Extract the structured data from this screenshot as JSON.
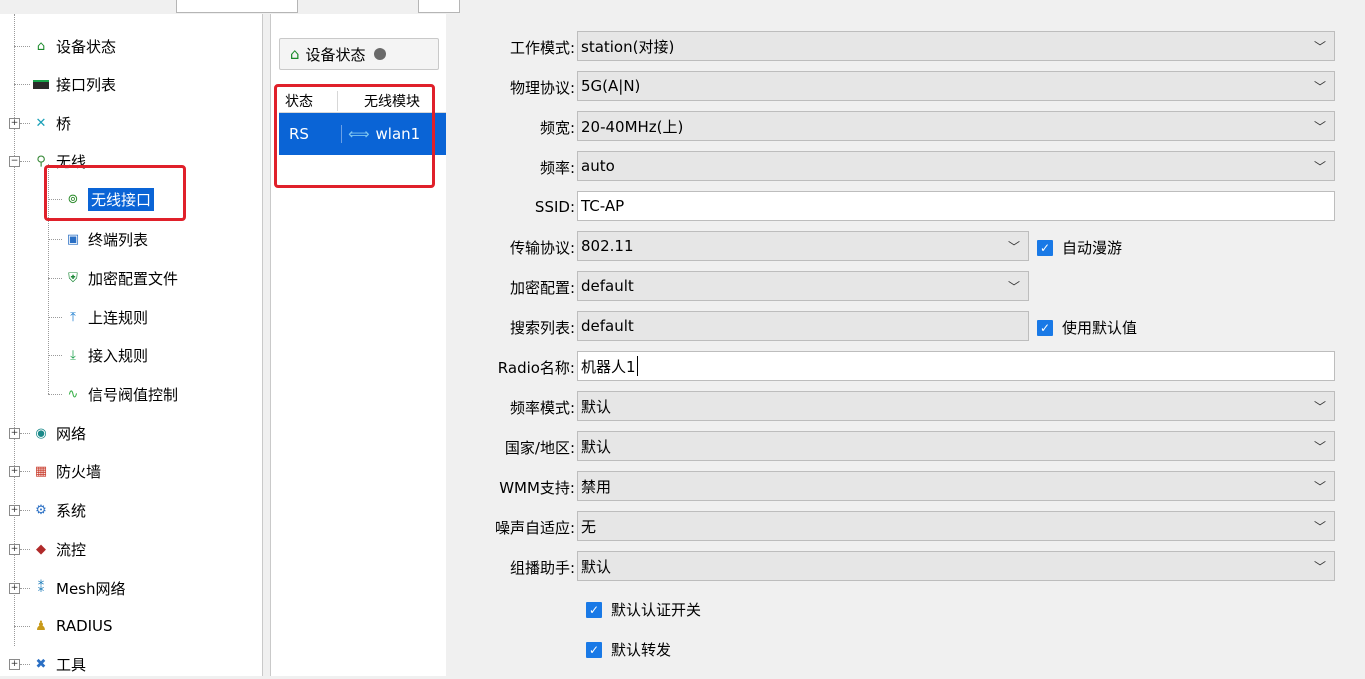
{
  "tree": {
    "items": [
      {
        "label": "设备状态",
        "icon": "device-status-icon"
      },
      {
        "label": "接口列表",
        "icon": "interface-list-icon"
      },
      {
        "label": "桥",
        "icon": "bridge-icon"
      },
      {
        "label": "无线",
        "icon": "wireless-icon"
      },
      {
        "label": "无线接口",
        "icon": "wireless-interface-icon"
      },
      {
        "label": "终端列表",
        "icon": "terminal-list-icon"
      },
      {
        "label": "加密配置文件",
        "icon": "encryption-profile-icon"
      },
      {
        "label": "上连规则",
        "icon": "uplink-rule-icon"
      },
      {
        "label": "接入规则",
        "icon": "access-rule-icon"
      },
      {
        "label": "信号阀值控制",
        "icon": "signal-threshold-icon"
      },
      {
        "label": "网络",
        "icon": "network-icon"
      },
      {
        "label": "防火墙",
        "icon": "firewall-icon"
      },
      {
        "label": "系统",
        "icon": "system-icon"
      },
      {
        "label": "流控",
        "icon": "flow-control-icon"
      },
      {
        "label": "Mesh网络",
        "icon": "mesh-network-icon"
      },
      {
        "label": "RADIUS",
        "icon": "radius-icon"
      },
      {
        "label": "工具",
        "icon": "tools-icon"
      }
    ]
  },
  "middle": {
    "tab_label": "设备状态",
    "col_status": "状态",
    "col_wireless": "无线模块",
    "row_status": "RS",
    "row_name": "wlan1"
  },
  "form": {
    "work_mode": {
      "label": "工作模式:",
      "value": "station(对接)"
    },
    "phy_protocol": {
      "label": "物理协议:",
      "value": "5G(A|N)"
    },
    "bandwidth": {
      "label": "频宽:",
      "value": "20-40MHz(上)"
    },
    "frequency": {
      "label": "频率:",
      "value": "auto"
    },
    "ssid": {
      "label": "SSID:",
      "value": "TC-AP"
    },
    "transport": {
      "label": "传输协议:",
      "value": "802.11"
    },
    "auto_roam": {
      "label": "自动漫游",
      "checked": true
    },
    "encryption": {
      "label": "加密配置:",
      "value": "default"
    },
    "search_list": {
      "label": "搜索列表:",
      "value": "default"
    },
    "use_default": {
      "label": "使用默认值",
      "checked": true
    },
    "radio_name": {
      "label": "Radio名称:",
      "value": "机器人1"
    },
    "freq_mode": {
      "label": "频率模式:",
      "value": "默认"
    },
    "country": {
      "label": "国家/地区:",
      "value": "默认"
    },
    "wmm": {
      "label": "WMM支持:",
      "value": "禁用"
    },
    "noise": {
      "label": "噪声自适应:",
      "value": "无"
    },
    "multicast": {
      "label": "组播助手:",
      "value": "默认"
    },
    "default_auth": {
      "label": "默认认证开关",
      "checked": true
    },
    "default_forward": {
      "label": "默认转发",
      "checked": true
    }
  },
  "colors": {
    "accent": "#0a64d6",
    "highlight_box": "#e0202a",
    "checkbox": "#1979e6"
  }
}
